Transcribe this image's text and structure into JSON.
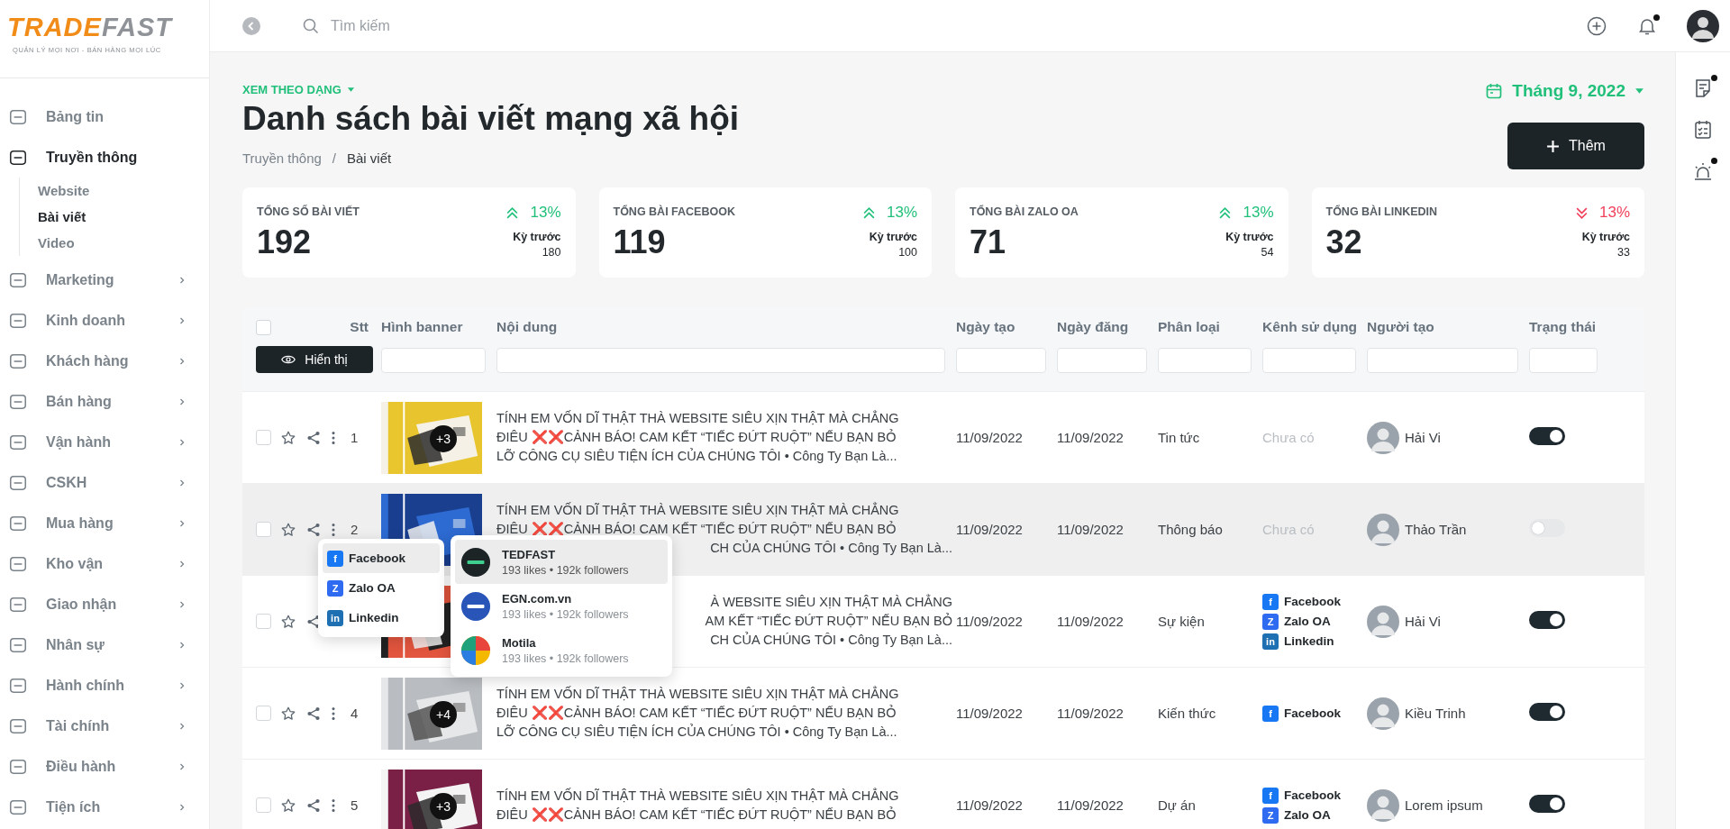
{
  "logo": {
    "part1": "TRADE",
    "part2": "FAST",
    "tagline": "QUẢN LÝ MỌI NƠI - BÁN HÀNG MỌI LÚC"
  },
  "sidebar": {
    "items": [
      {
        "label": "Bảng tin",
        "selected": false
      },
      {
        "label": "Truyền thông",
        "selected": true,
        "expanded": true,
        "children": [
          {
            "label": "Website",
            "selected": false
          },
          {
            "label": "Bài viết",
            "selected": true
          },
          {
            "label": "Video",
            "selected": false
          }
        ]
      },
      {
        "label": "Marketing",
        "selected": false,
        "expanded": false
      },
      {
        "label": "Kinh doanh",
        "selected": false,
        "expanded": false
      },
      {
        "label": "Khách hàng",
        "selected": false,
        "expanded": false
      },
      {
        "label": "Bán hàng",
        "selected": false,
        "expanded": false
      },
      {
        "label": "Vận hành",
        "selected": false,
        "expanded": false
      },
      {
        "label": "CSKH",
        "selected": false,
        "expanded": false
      },
      {
        "label": "Mua hàng",
        "selected": false,
        "expanded": false
      },
      {
        "label": "Kho vận",
        "selected": false,
        "expanded": false
      },
      {
        "label": "Giao nhận",
        "selected": false,
        "expanded": false
      },
      {
        "label": "Nhân sự",
        "selected": false,
        "expanded": false
      },
      {
        "label": "Hành chính",
        "selected": false,
        "expanded": false
      },
      {
        "label": "Tài chính",
        "selected": false,
        "expanded": false
      },
      {
        "label": "Điều hành",
        "selected": false,
        "expanded": false
      },
      {
        "label": "Tiện ích",
        "selected": false,
        "expanded": false
      }
    ]
  },
  "topbar": {
    "search": {
      "placeholder": "Tìm kiếm"
    },
    "notification_dot": true
  },
  "right_rail": [
    {
      "dot": true
    },
    {
      "dot": false
    },
    {
      "dot": true
    }
  ],
  "page": {
    "view_mode": "XEM THEO DẠNG",
    "title": "Danh sách bài viết mạng xã hội",
    "breadcrumb": [
      "Truyền thông",
      "Bài viết"
    ],
    "separator": "/",
    "month": "Tháng 9, 2022",
    "add_button": "Thêm"
  },
  "stats": [
    {
      "label": "TỔNG SỐ BÀI VIẾT",
      "value": "192",
      "change": "13%",
      "rising": true,
      "previous_label": "Kỳ trước",
      "previous": "180"
    },
    {
      "label": "TỔNG BÀI FACEBOOK",
      "value": "119",
      "change": "13%",
      "rising": true,
      "previous_label": "Kỳ trước",
      "previous": "100"
    },
    {
      "label": "TỔNG BÀI ZALO OA",
      "value": "71",
      "change": "13%",
      "rising": true,
      "previous_label": "Kỳ trước",
      "previous": "54"
    },
    {
      "label": "TỔNG BÀI LINKEDIN",
      "value": "32",
      "change": "13%",
      "rising": false,
      "previous_label": "Kỳ trước",
      "previous": "33"
    }
  ],
  "table": {
    "columns": [
      "Stt",
      "Hình banner",
      "Nội dung",
      "Ngày tạo",
      "Ngày đăng",
      "Phân loại",
      "Kênh sử dụng",
      "Người tạo",
      "Trạng thái"
    ],
    "select_all_checked": false,
    "show_button": "Hiển thị",
    "rows": [
      {
        "stt": "1",
        "checked": false,
        "selected": false,
        "more": "+3",
        "lines": [
          {
            "text": "TÍNH EM VỐN DĨ THẬT THÀ WEBSITE SIÊU XỊN THẬT MÀ CHẲNG",
            "covered": false
          },
          {
            "text": "ĐIÊU ❌❌CẢNH BÁO! CAM KẾT “TIẾC ĐỨT RUỘT” NẾU BẠN BỎ",
            "covered": false
          },
          {
            "text": "LỠ CÔNG CỤ SIÊU TIỆN ÍCH CỦA CHÚNG TÔI • Công Ty Bạn Là...",
            "covered": false
          }
        ],
        "created": "11/09/2022",
        "posted": "11/09/2022",
        "category": "Tin tức",
        "channels": [],
        "no_channel": "Chưa có",
        "author": "Hải Vi",
        "on": true
      },
      {
        "stt": "2",
        "checked": false,
        "selected": true,
        "lines": [
          {
            "text": "TÍNH EM VỐN DĨ THẬT THÀ WEBSITE SIÊU XỊN THẬT MÀ CHẲNG",
            "covered": false
          },
          {
            "text": "ĐIÊU ❌❌CẢNH BÁO! CAM KẾT “TIẾC ĐỨT RUỘT” NẾU BẠN BỎ",
            "covered": false
          },
          {
            "text": "CH CỦA CHÚNG TÔI • Công Ty Bạn Là...",
            "covered": true
          }
        ],
        "created": "11/09/2022",
        "posted": "11/09/2022",
        "category": "Thông báo",
        "channels": [],
        "no_channel": "Chưa có",
        "author": "Thảo Trần",
        "on": false
      },
      {
        "checked": false,
        "selected": false,
        "lines": [
          {
            "text": "À WEBSITE SIÊU XỊN THẬT MÀ CHẲNG",
            "covered": true
          },
          {
            "text": "AM KẾT “TIẾC ĐỨT RUỘT” NẾU BẠN BỎ",
            "covered": true
          },
          {
            "text": "CH CỦA CHÚNG TÔI • Công Ty Bạn Là...",
            "covered": true
          }
        ],
        "created": "11/09/2022",
        "posted": "11/09/2022",
        "category": "Sự kiện",
        "channels": [
          {
            "name": "Facebook",
            "icon_text": "f",
            "color": "#1877f2"
          },
          {
            "name": "Zalo OA",
            "icon_text": "Z",
            "color": "#2f6bf0"
          },
          {
            "name": "Linkedin",
            "icon_text": "in",
            "color": "#1f6fb3"
          }
        ],
        "author": "Hải Vi",
        "on": true
      },
      {
        "stt": "4",
        "checked": false,
        "selected": false,
        "more": "+4",
        "lines": [
          {
            "text": "TÍNH EM VỐN DĨ THẬT THÀ WEBSITE SIÊU XỊN THẬT MÀ CHẲNG",
            "covered": false
          },
          {
            "text": "ĐIÊU ❌❌CẢNH BÁO! CAM KẾT “TIẾC ĐỨT RUỘT” NẾU BẠN BỎ",
            "covered": false
          },
          {
            "text": "LỠ CÔNG CỤ SIÊU TIỆN ÍCH CỦA CHÚNG TÔI • Công Ty Bạn Là...",
            "covered": false
          }
        ],
        "created": "11/09/2022",
        "posted": "11/09/2022",
        "category": "Kiến thức",
        "channels": [
          {
            "name": "Facebook",
            "icon_text": "f",
            "color": "#1877f2"
          }
        ],
        "author": "Kiều Trinh",
        "on": true
      },
      {
        "stt": "5",
        "checked": false,
        "selected": false,
        "more": "+3",
        "lines": [
          {
            "text": "TÍNH EM VỐN DĨ THẬT THÀ WEBSITE SIÊU XỊN THẬT MÀ CHẲNG",
            "covered": false
          },
          {
            "text": "ĐIÊU ❌❌CẢNH BÁO! CAM KẾT “TIẾC ĐỨT RUỘT” NẾU BẠN BỎ",
            "covered": false
          }
        ],
        "created": "11/09/2022",
        "posted": "11/09/2022",
        "category": "Dự án",
        "channels": [
          {
            "name": "Facebook",
            "icon_text": "f",
            "color": "#1877f2"
          },
          {
            "name": "Zalo OA",
            "icon_text": "Z",
            "color": "#2f6bf0"
          }
        ],
        "author": "Lorem ipsum",
        "on": true
      }
    ]
  },
  "share_menu": {
    "channels": [
      {
        "name": "Facebook",
        "icon_text": "f",
        "color": "#1877f2",
        "selected": true
      },
      {
        "name": "Zalo OA",
        "icon_text": "Z",
        "color": "#2f6bf0",
        "selected": false
      },
      {
        "name": "Linkedin",
        "icon_text": "in",
        "color": "#1f6fb3",
        "selected": false
      }
    ],
    "pages": [
      {
        "name": "TEDFAST",
        "stats": "193 likes • 192k followers",
        "selected": true
      },
      {
        "name": "EGN.com.vn",
        "stats": "193 likes • 192k followers",
        "selected": false
      },
      {
        "name": "Motila",
        "stats": "193 likes • 192k followers",
        "selected": false
      }
    ]
  }
}
